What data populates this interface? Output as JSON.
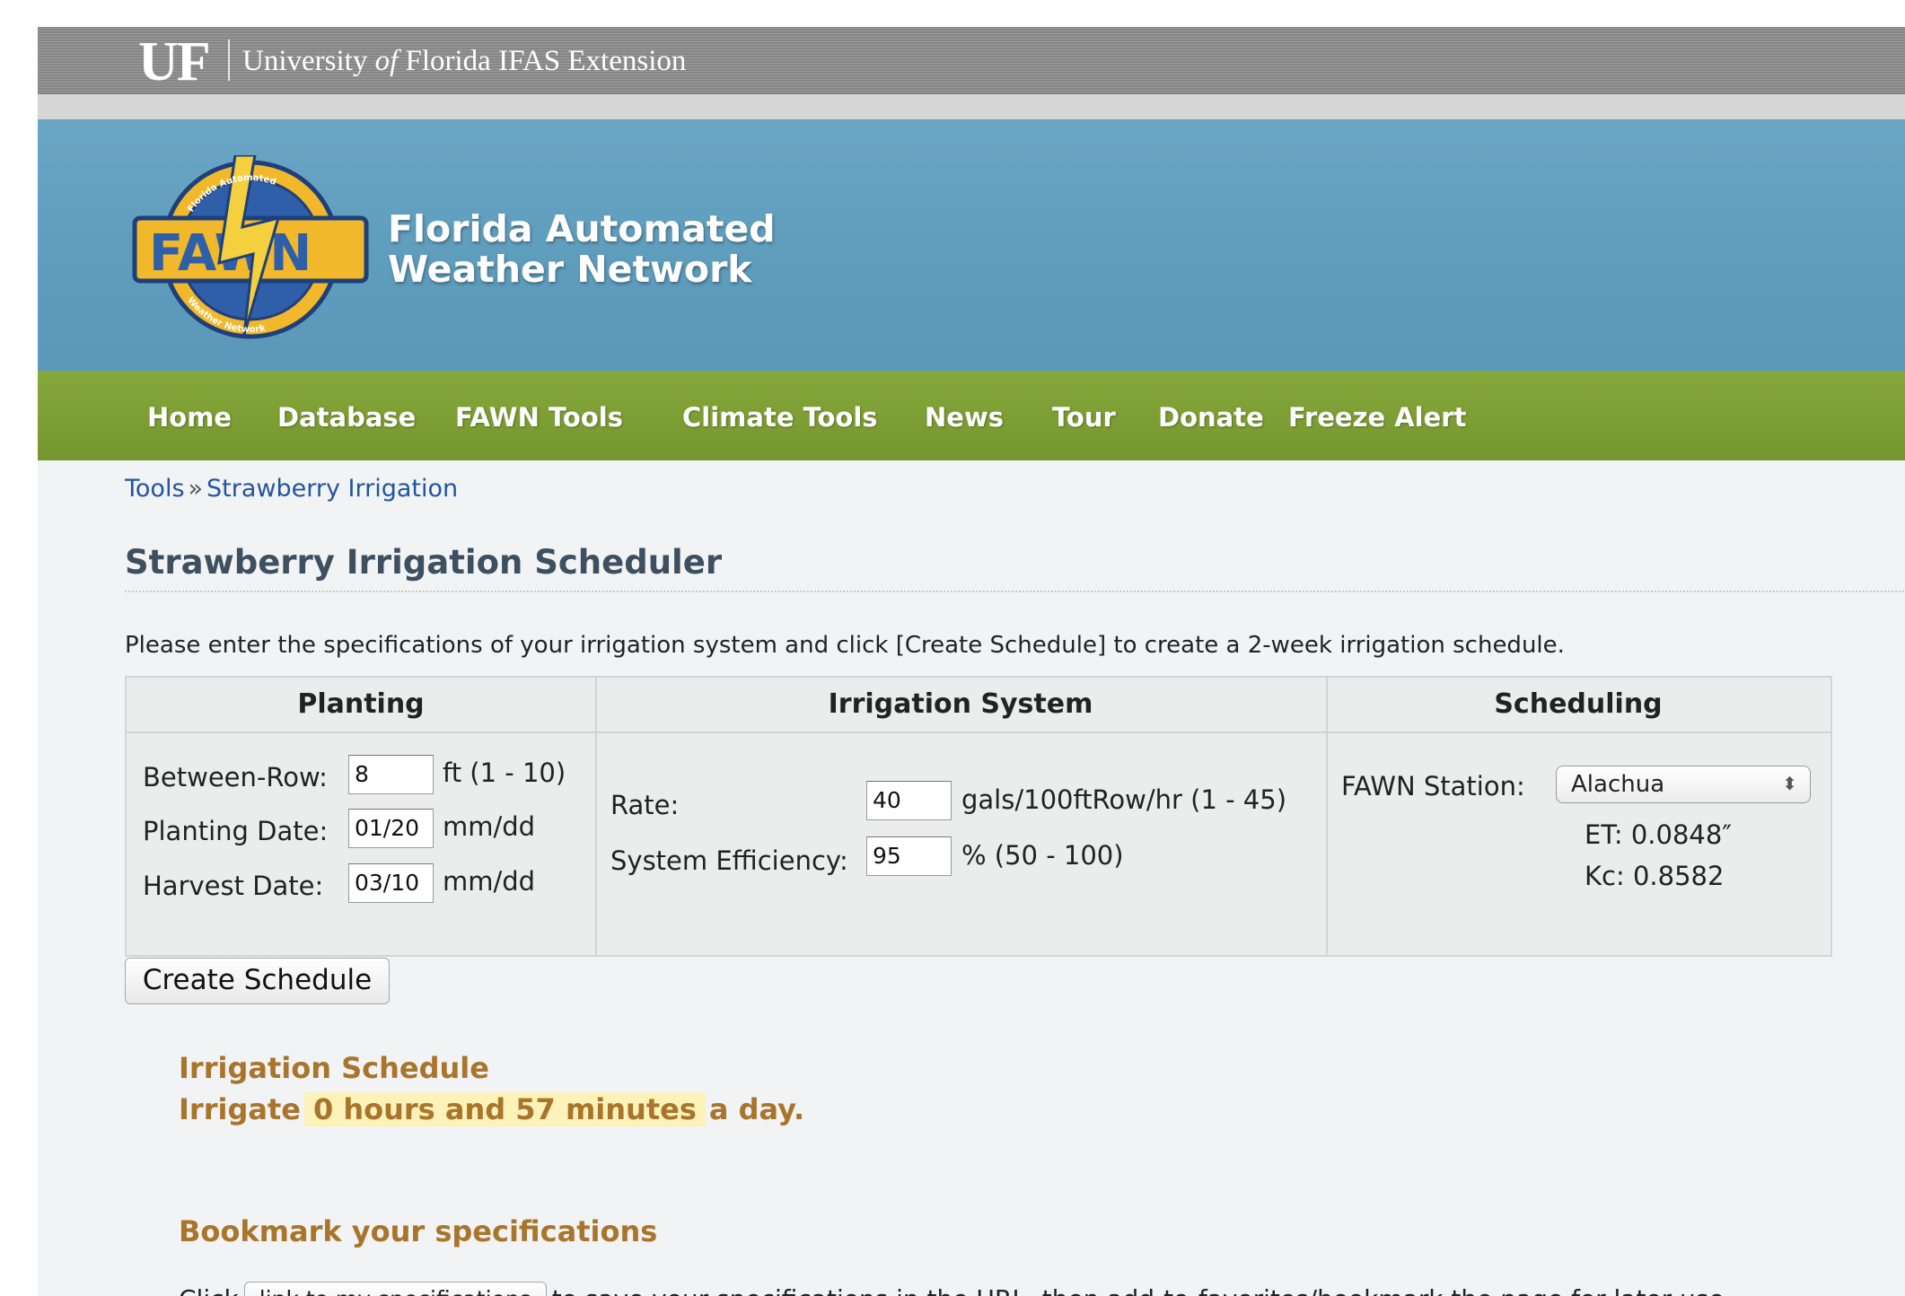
{
  "topbar": {
    "logo": "UF",
    "org_prefix": "University",
    "org_of": "of",
    "org_suffix": "Florida IFAS Extension"
  },
  "header": {
    "logo_letters": "FAWN",
    "logo_ring_text_top": "Florida Automated",
    "logo_ring_text_bottom": "Weather Network",
    "title_line1": "Florida Automated",
    "title_line2": "Weather Network",
    "colors": {
      "banner": "#6aa6c4",
      "nav": "#7c9d33",
      "logo_yellow": "#f0b82a"
    }
  },
  "nav": {
    "items": [
      "Home",
      "Database",
      "FAWN Tools",
      "Climate Tools",
      "News",
      "Tour",
      "Donate",
      "Freeze Alert"
    ]
  },
  "breadcrumb": {
    "parent": "Tools",
    "separator": "»",
    "current": "Strawberry Irrigation"
  },
  "page": {
    "title": "Strawberry Irrigation Scheduler",
    "intro": "Please enter the specifications of your irrigation system and click [Create Schedule] to create a 2-week irrigation schedule."
  },
  "form": {
    "headers": {
      "planting": "Planting",
      "irrigation": "Irrigation System",
      "scheduling": "Scheduling"
    },
    "planting": {
      "between_row_label": "Between-Row:",
      "between_row_value": "8",
      "between_row_unit": "ft (1 - 10)",
      "planting_date_label": "Planting Date:",
      "planting_date_value": "01/20",
      "planting_date_unit": "mm/dd",
      "harvest_date_label": "Harvest Date:",
      "harvest_date_value": "03/10",
      "harvest_date_unit": "mm/dd"
    },
    "irrigation": {
      "rate_label": "Rate:",
      "rate_value": "40",
      "rate_unit": "gals/100ftRow/hr (1 - 45)",
      "efficiency_label": "System Efficiency:",
      "efficiency_value": "95",
      "efficiency_unit": "% (50 - 100)"
    },
    "scheduling": {
      "station_label": "FAWN Station:",
      "station_value": "Alachua",
      "et": "ET: 0.0848″",
      "kc": "Kc: 0.8582"
    },
    "create_button": "Create Schedule"
  },
  "schedule": {
    "title": "Irrigation Schedule",
    "prefix": "Irrigate",
    "duration": "0 hours and 57 minutes",
    "suffix": "a day."
  },
  "bookmark": {
    "title": "Bookmark your specifications",
    "prefix": "Click",
    "button": "link to my specifications",
    "suffix": "to save your specifications in the URL, then add-to-favorites/bookmark the page for later use."
  }
}
